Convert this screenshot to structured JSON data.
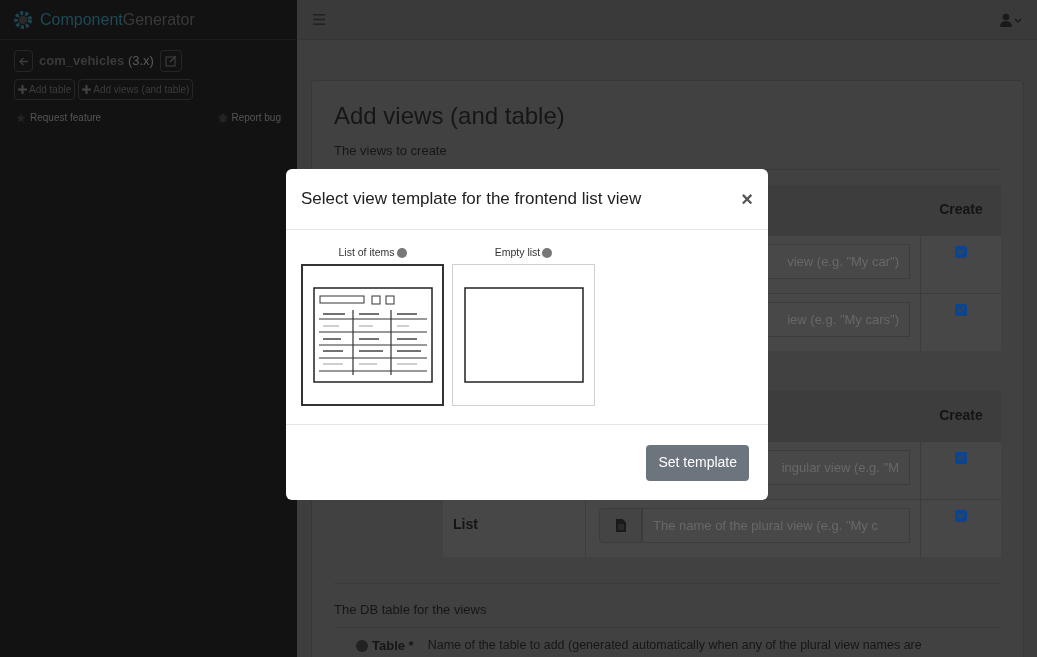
{
  "sidebar": {
    "logo": {
      "part_1": "Component",
      "part_2": "Generator"
    },
    "project": {
      "name": "com_vehicles",
      "version": "(3.x)"
    },
    "buttons": [
      {
        "label": "Add table"
      },
      {
        "label": "Add views (and table)"
      }
    ],
    "links": [
      {
        "label": "Request feature",
        "kind": "star"
      },
      {
        "label": "Report bug",
        "kind": "bug"
      }
    ]
  },
  "page": {
    "title": "Add views (and table)",
    "views_heading": "The views to create",
    "tables": [
      {
        "header": "Create",
        "rows": [
          {
            "kind": "plain",
            "placeholder": "view (e.g. \"My car\")",
            "create": true
          },
          {
            "kind": "plain",
            "placeholder": "iew (e.g. \"My cars\")",
            "create": true
          }
        ]
      },
      {
        "header": "Create",
        "rows": [
          {
            "kind": "plain",
            "placeholder": "ingular view (e.g. \"M",
            "create": true
          },
          {
            "kind": "with_icon",
            "name": "List",
            "placeholder": "The name of the plural view (e.g. \"My c",
            "create": true
          }
        ]
      }
    ],
    "db_heading": "The DB table for the views",
    "field_label": "Table *",
    "field_description": "Name of the table to add (generated automatically when any of the plural view names are"
  },
  "modal": {
    "title": "Select view template for the frontend list view",
    "close": "×",
    "templates": [
      {
        "label": "List of items",
        "kind": "list",
        "selected": true
      },
      {
        "label": "Empty list",
        "kind": "empty",
        "selected": false
      }
    ],
    "button": "Set template"
  }
}
